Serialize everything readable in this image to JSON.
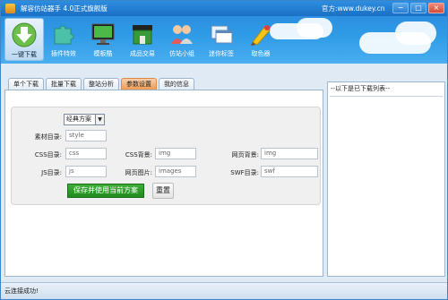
{
  "window": {
    "title": "解容仿站器手 4.0正式旗舰版",
    "website": "官方:www.dukey.cn",
    "min_symbol": "−",
    "max_symbol": "□",
    "close_symbol": "×"
  },
  "toolbar": {
    "items": [
      {
        "label": "一键下载",
        "icon": "download-arrow-icon",
        "active": true
      },
      {
        "label": "插件特效",
        "icon": "puzzle-icon",
        "active": false
      },
      {
        "label": "模板酷",
        "icon": "monitor-icon",
        "active": false
      },
      {
        "label": "成品交易",
        "icon": "shop-icon",
        "active": false
      },
      {
        "label": "仿站小组",
        "icon": "people-icon",
        "active": false
      },
      {
        "label": "迷你标签",
        "icon": "windows-icon",
        "active": false
      },
      {
        "label": "取色器",
        "icon": "color-picker-icon",
        "active": false
      }
    ]
  },
  "tabs": [
    {
      "label": "单个下载",
      "active": false
    },
    {
      "label": "批量下载",
      "active": false
    },
    {
      "label": "整站分析",
      "active": false
    },
    {
      "label": "参数设置",
      "active": true
    },
    {
      "label": "我的信息",
      "active": false
    }
  ],
  "settings": {
    "scheme": {
      "value": "经典方案",
      "arrow": "▼"
    },
    "material_dir": {
      "label": "素材目录:",
      "value": "style"
    },
    "css_dir": {
      "label": "CSS目录:",
      "value": "css"
    },
    "css_bg": {
      "label": "CSS背景:",
      "value": "img"
    },
    "page_bg": {
      "label": "网页背景:",
      "value": "img"
    },
    "js_dir": {
      "label": "JS目录:",
      "value": "js"
    },
    "page_img": {
      "label": "网页图片:",
      "value": "images"
    },
    "swf_dir": {
      "label": "SWF目录:",
      "value": "swf"
    },
    "save_button": "保存并使用当前方案",
    "reset_button": "重置"
  },
  "right_pane": {
    "header": "--以下是已下载列表--"
  },
  "status": {
    "text": "云连接成功!"
  },
  "colors": {
    "title_bar": "#1a6fc4",
    "save_button": "#1f8a1d",
    "active_tab": "#f09a52"
  }
}
